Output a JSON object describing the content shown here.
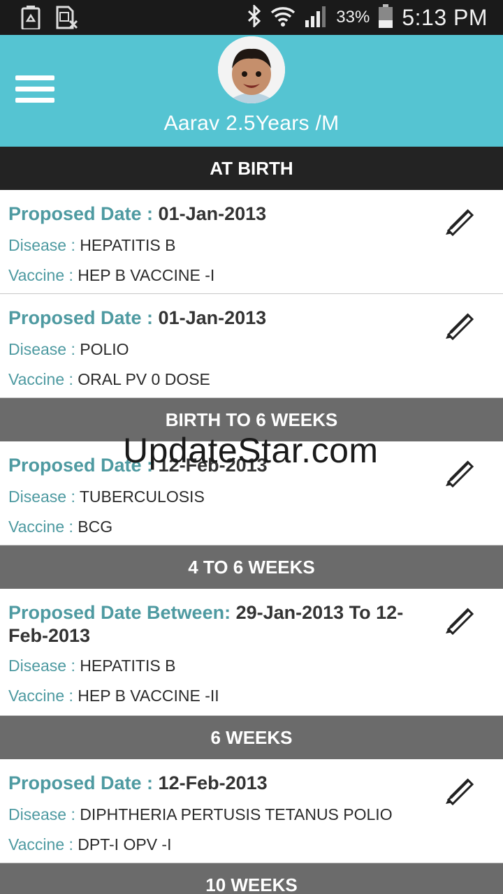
{
  "status_bar": {
    "battery_percent": "33%",
    "time": "5:13 PM",
    "icons": [
      "recycle-battery-icon",
      "sim-card-x-icon",
      "bluetooth-icon",
      "wifi-icon",
      "signal-icon",
      "battery-icon"
    ]
  },
  "header": {
    "profile_name": "Aarav 2.5Years /M",
    "background_color": "#55c4d2",
    "icons": [
      "menu-icon",
      "avatar"
    ]
  },
  "sections": [
    {
      "title": "AT BIRTH",
      "items": [
        {
          "date_label": "Proposed Date : ",
          "date_value": "01-Jan-2013",
          "disease_label": "Disease : ",
          "disease": "HEPATITIS B",
          "vaccine_label": "Vaccine : ",
          "vaccine": "HEP B VACCINE -I"
        },
        {
          "date_label": "Proposed Date : ",
          "date_value": "01-Jan-2013",
          "disease_label": "Disease : ",
          "disease": "POLIO",
          "vaccine_label": "Vaccine : ",
          "vaccine": "ORAL PV 0 DOSE"
        }
      ]
    },
    {
      "title": "BIRTH TO 6 WEEKS",
      "items": [
        {
          "date_label": "Proposed Date : ",
          "date_value": "12-Feb-2013",
          "disease_label": "Disease : ",
          "disease": "TUBERCULOSIS",
          "vaccine_label": "Vaccine : ",
          "vaccine": "BCG"
        }
      ]
    },
    {
      "title": "4 TO 6 WEEKS",
      "items": [
        {
          "date_label": "Proposed Date Between: ",
          "date_value": "29-Jan-2013 To 12-Feb-2013",
          "disease_label": "Disease : ",
          "disease": "HEPATITIS B",
          "vaccine_label": "Vaccine : ",
          "vaccine": "HEP B VACCINE -II"
        }
      ]
    },
    {
      "title": "6 WEEKS",
      "items": [
        {
          "date_label": "Proposed Date : ",
          "date_value": "12-Feb-2013",
          "disease_label": "Disease : ",
          "disease": "DIPHTHERIA PERTUSIS TETANUS POLIO",
          "vaccine_label": "Vaccine : ",
          "vaccine": "DPT-I OPV -I"
        }
      ]
    },
    {
      "title": "10 WEEKS",
      "items": []
    }
  ],
  "watermark": "UpdateStar.com",
  "colors": {
    "accent_teal": "#4e9aa1",
    "section_dark": "#232323",
    "section_grey": "#6b6b6b"
  }
}
